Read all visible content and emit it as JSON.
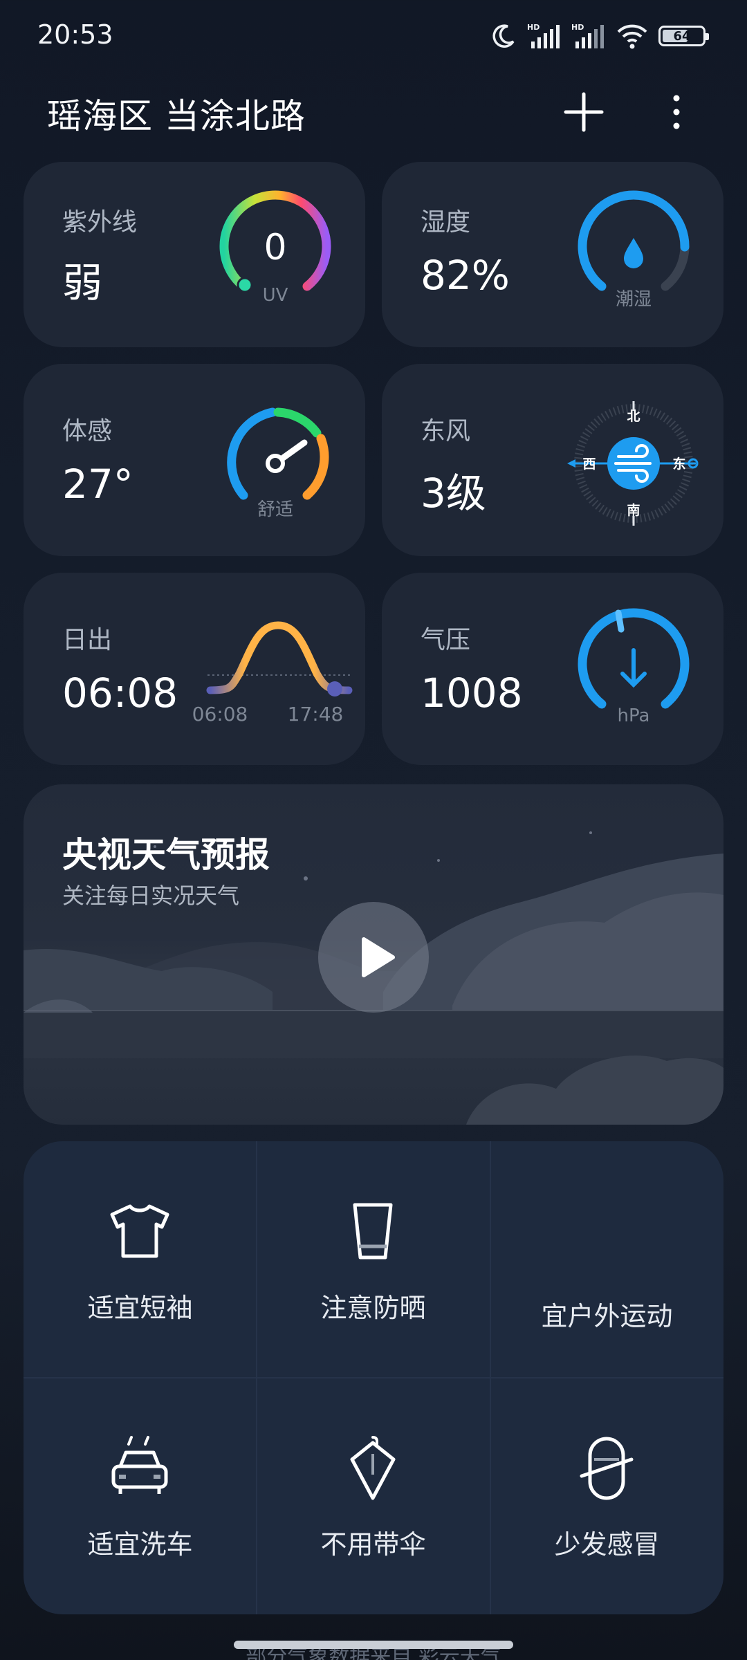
{
  "status_bar": {
    "time": "20:53",
    "battery": "64",
    "battery_level": 0.64,
    "hd1": "HD",
    "hd2": "HD"
  },
  "header": {
    "location": "瑶海区 当涂北路"
  },
  "cards": {
    "uv": {
      "label": "紫外线",
      "value": "弱",
      "gauge_value": "0",
      "gauge_unit": "UV"
    },
    "humidity": {
      "label": "湿度",
      "value": "82%",
      "gauge_caption": "潮湿",
      "level": 0.82
    },
    "feels_like": {
      "label": "体感",
      "value": "27°",
      "gauge_caption": "舒适"
    },
    "wind": {
      "label": "东风",
      "value": "3级",
      "n": "北",
      "s": "南",
      "w": "西",
      "e": "东"
    },
    "sunrise": {
      "label": "日出",
      "value": "06:08",
      "rise": "06:08",
      "set": "17:48"
    },
    "pressure": {
      "label": "气压",
      "value": "1008",
      "unit": "hPa"
    }
  },
  "video": {
    "title": "央视天气预报",
    "subtitle": "关注每日实况天气"
  },
  "tips": [
    {
      "label": "适宜短袖",
      "icon": "tshirt-icon"
    },
    {
      "label": "注意防晒",
      "icon": "sunscreen-icon"
    },
    {
      "label": "宜户外运动",
      "icon": ""
    },
    {
      "label": "适宜洗车",
      "icon": "car-wash-icon"
    },
    {
      "label": "不用带伞",
      "icon": "umbrella-icon"
    },
    {
      "label": "少发感冒",
      "icon": "pill-icon"
    }
  ],
  "footer": {
    "text": "部分气象数据来自 彩云天气"
  },
  "colors": {
    "card": "#1f2736",
    "accent_blue": "#1e9cf0",
    "bg": "#151d2b"
  }
}
